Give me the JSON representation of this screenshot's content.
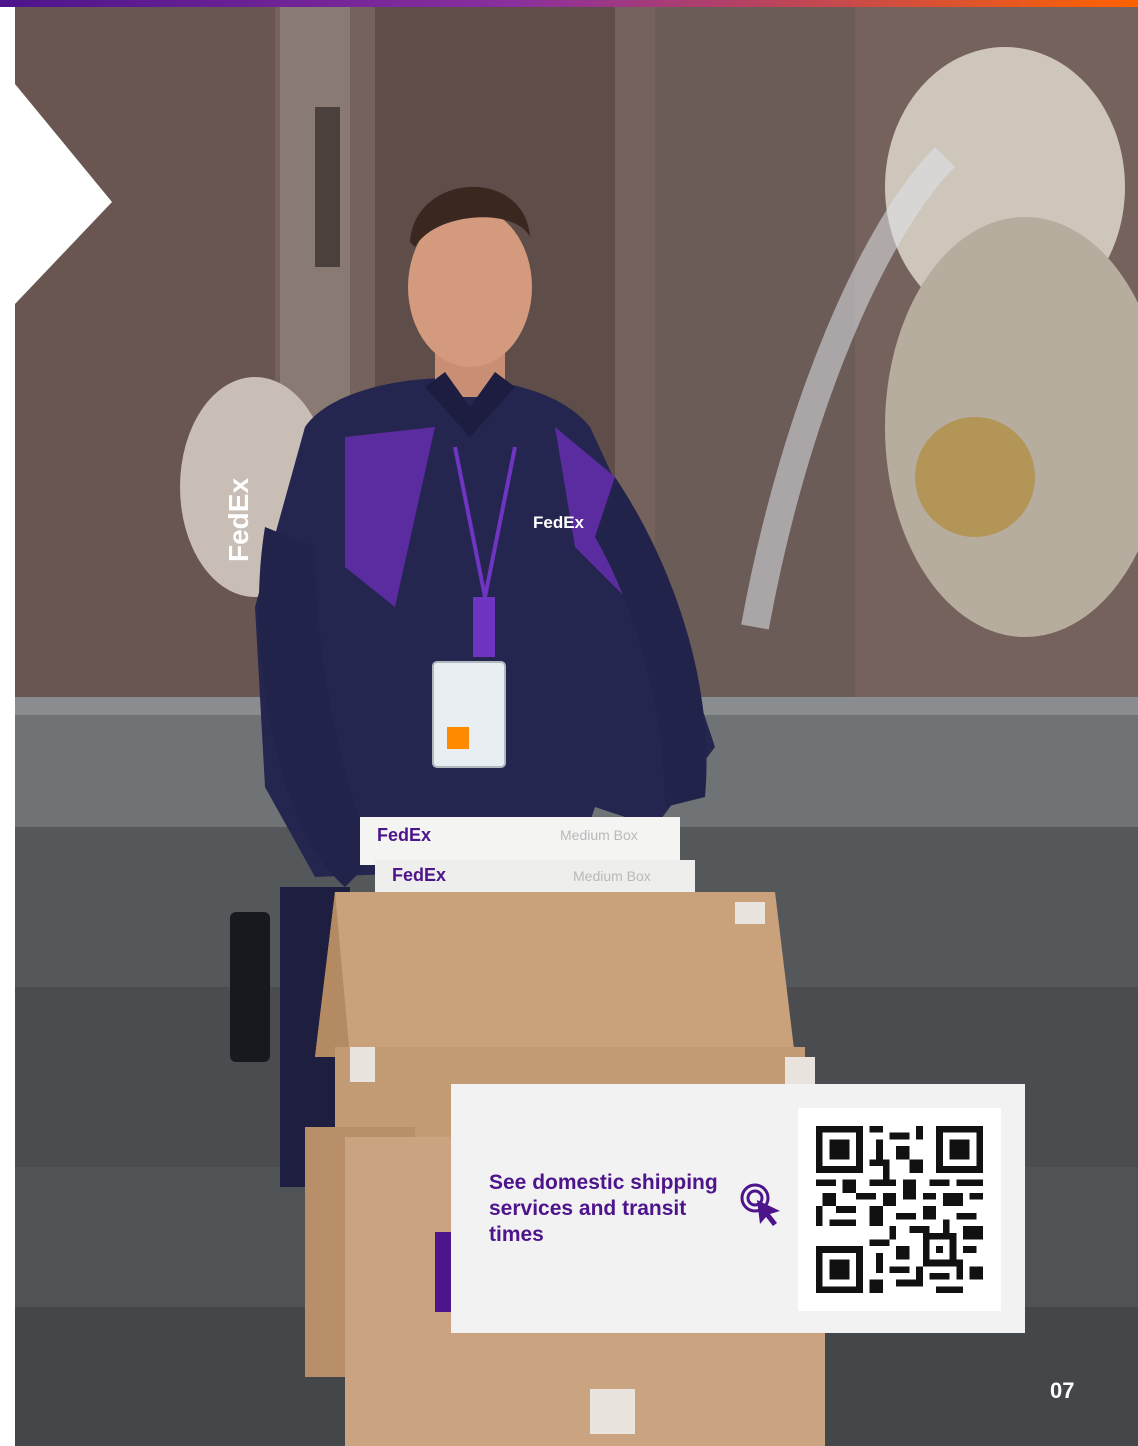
{
  "header": {
    "accent_bar_colors": [
      "#4d148c",
      "#ff6200"
    ]
  },
  "photo": {
    "shirt_logo": "FedEx",
    "sleeve_logo": "FedEx",
    "box_top_brand": "FedEx",
    "box_top_label": "Medium Box",
    "box_second_brand": "FedEx",
    "box_second_label": "Medium Box"
  },
  "cta_card": {
    "text": "See domestic shipping services and transit times",
    "icon": "click-cursor-icon",
    "qr_icon": "qr-code-icon"
  },
  "footer": {
    "page_number": "07"
  },
  "colors": {
    "brand_purple": "#4d148c",
    "brand_orange": "#ff6200",
    "card_background": "#f2f2f2"
  }
}
